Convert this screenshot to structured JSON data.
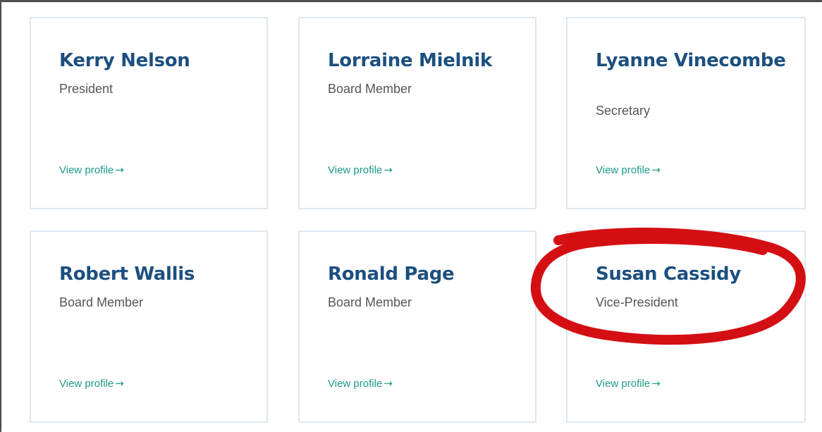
{
  "cards": [
    {
      "name": "Kerry Nelson",
      "role": "President",
      "link": "View profile",
      "arrow": "→"
    },
    {
      "name": "Lorraine Mielnik",
      "role": "Board Member",
      "link": "View profile",
      "arrow": "→"
    },
    {
      "name": "Lyanne Vinecombe",
      "role": "Secretary",
      "link": "View profile",
      "arrow": "→"
    },
    {
      "name": "Robert Wallis",
      "role": "Board Member",
      "link": "View profile",
      "arrow": "→"
    },
    {
      "name": "Ronald Page",
      "role": "Board Member",
      "link": "View profile",
      "arrow": "→"
    },
    {
      "name": "Susan Cassidy",
      "role": "Vice-President",
      "link": "View profile",
      "arrow": "→"
    }
  ],
  "colors": {
    "name": "#1c4f7f",
    "role": "#555555",
    "link": "#1f9a8a",
    "card_border": "#dfe7ee",
    "annotation": "#d40f14"
  },
  "annotation": {
    "target": "Susan Cassidy",
    "shape": "freehand-ellipse"
  }
}
